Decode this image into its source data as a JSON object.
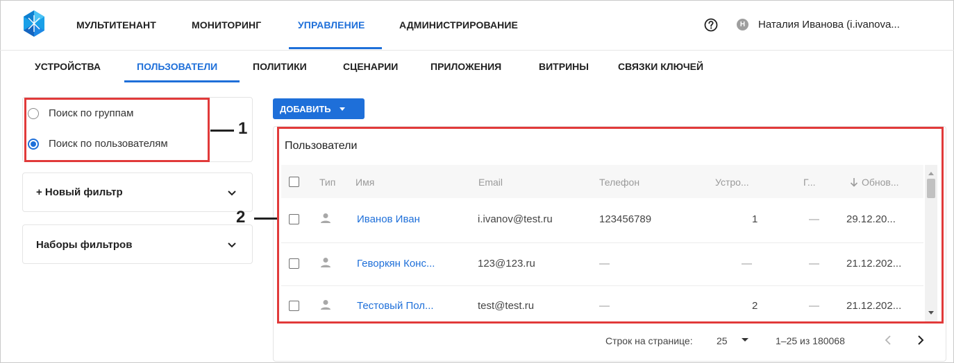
{
  "topnav": {
    "items": [
      "МУЛЬТИТЕНАНТ",
      "МОНИТОРИНГ",
      "УПРАВЛЕНИЕ",
      "АДМИНИСТРИРОВАНИЕ"
    ],
    "active": "УПРАВЛЕНИЕ",
    "user_initial": "Н",
    "user_name": "Наталия Иванова (i.ivanova..."
  },
  "subnav": {
    "items": [
      "УСТРОЙСТВА",
      "ПОЛЬЗОВАТЕЛИ",
      "ПОЛИТИКИ",
      "СЦЕНАРИИ",
      "ПРИЛОЖЕНИЯ",
      "ВИТРИНЫ",
      "СВЯЗКИ КЛЮЧЕЙ"
    ],
    "active": "ПОЛЬЗОВАТЕЛИ"
  },
  "search_mode": {
    "options": [
      "Поиск по группам",
      "Поиск по пользователям"
    ],
    "selected": "Поиск по пользователям"
  },
  "filters": {
    "new_filter": "+ Новый фильтр",
    "filter_sets": "Наборы фильтров"
  },
  "callouts": [
    "1",
    "2"
  ],
  "add_button": "ДОБАВИТЬ",
  "table": {
    "title": "Пользователи",
    "columns": [
      "Тип",
      "Имя",
      "Email",
      "Телефон",
      "Устро...",
      "Г...",
      "Обнов..."
    ],
    "sort_column": "Обнов...",
    "rows": [
      {
        "name": "Иванов Иван",
        "email": "i.ivanov@test.ru",
        "phone": "123456789",
        "devices": "1",
        "groups": "—",
        "updated": "29.12.20..."
      },
      {
        "name": "Геворкян Конс...",
        "email": "123@123.ru",
        "phone": "—",
        "devices": "—",
        "groups": "—",
        "updated": "21.12.202..."
      },
      {
        "name": "Тестовый Пол...",
        "email": "test@test.ru",
        "phone": "—",
        "devices": "2",
        "groups": "—",
        "updated": "21.12.202..."
      }
    ]
  },
  "pagination": {
    "rows_label": "Строк на странице:",
    "rows_value": "25",
    "range": "1–25 из 180068"
  },
  "colors": {
    "accent": "#1e6fd9",
    "callout_red": "#e13a3a"
  }
}
